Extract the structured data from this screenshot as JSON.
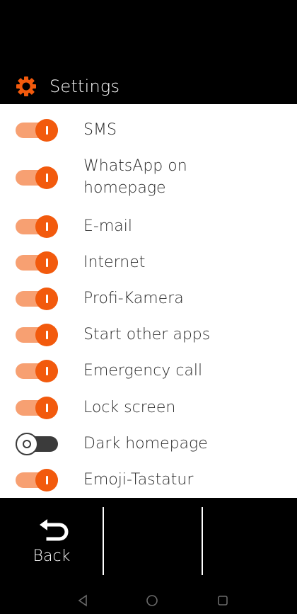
{
  "header": {
    "title": "Settings",
    "icon": "gear-icon",
    "accent_color": "#f25a0d"
  },
  "settings": [
    {
      "label": "SMS",
      "enabled": true
    },
    {
      "label": "WhatsApp on\nhomepage",
      "enabled": true
    },
    {
      "label": "E-mail",
      "enabled": true
    },
    {
      "label": "Internet",
      "enabled": true
    },
    {
      "label": "Profi-Kamera",
      "enabled": true
    },
    {
      "label": "Start other apps",
      "enabled": true
    },
    {
      "label": "Emergency call",
      "enabled": true
    },
    {
      "label": "Lock screen",
      "enabled": true
    },
    {
      "label": "Dark homepage",
      "enabled": false
    },
    {
      "label": "Emoji-Tastatur",
      "enabled": true
    }
  ],
  "bottom_bar": {
    "back_label": "Back",
    "back_icon": "back-arrow-icon"
  },
  "nav_bar": {
    "buttons": [
      "back-triangle-icon",
      "home-circle-icon",
      "recents-square-icon"
    ]
  },
  "colors": {
    "toggle_on_knob": "#f25a0d",
    "toggle_on_track": "#f7a072",
    "toggle_off": "#3b3b3b"
  }
}
